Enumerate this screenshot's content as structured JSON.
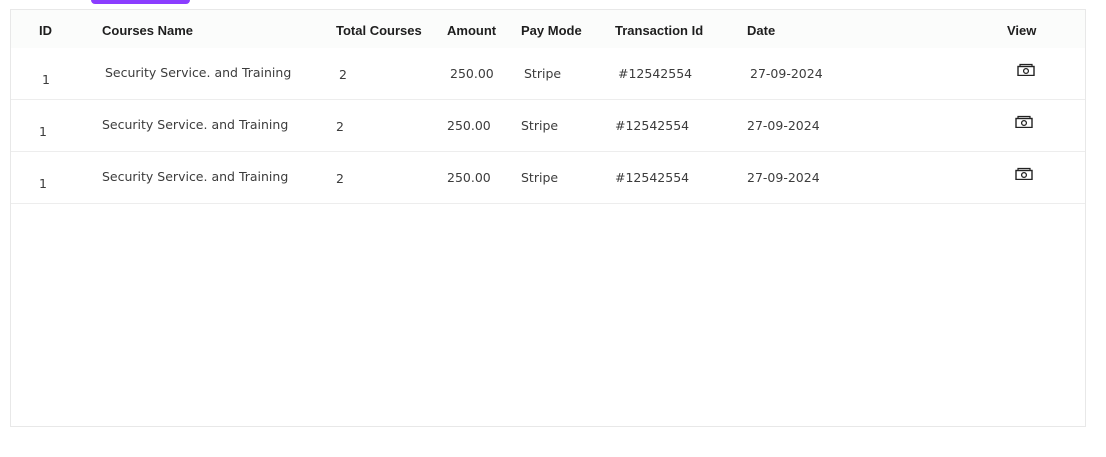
{
  "table": {
    "headers": {
      "id": "ID",
      "course_name": "Courses Name",
      "total_courses": "Total Courses",
      "amount": "Amount",
      "pay_mode": "Pay Mode",
      "transaction_id": "Transaction Id",
      "date": "Date",
      "view": "View"
    },
    "rows": [
      {
        "id": "1",
        "course_name": "Security Service. and Training",
        "total_courses": "2",
        "amount": "250.00",
        "pay_mode": "Stripe",
        "transaction_id": "#12542554",
        "date": "27-09-2024",
        "view_icon": "cash-icon"
      },
      {
        "id": "1",
        "course_name": "Security Service. and Training",
        "total_courses": "2",
        "amount": "250.00",
        "pay_mode": "Stripe",
        "transaction_id": "#12542554",
        "date": "27-09-2024",
        "view_icon": "cash-icon"
      },
      {
        "id": "1",
        "course_name": "Security Service. and Training",
        "total_courses": "2",
        "amount": "250.00",
        "pay_mode": "Stripe",
        "transaction_id": "#12542554",
        "date": "27-09-2024",
        "view_icon": "cash-icon"
      }
    ]
  },
  "colors": {
    "accent": "#8b3dff",
    "header_bg": "#fbfcfb",
    "row_divider": "#ededed"
  }
}
